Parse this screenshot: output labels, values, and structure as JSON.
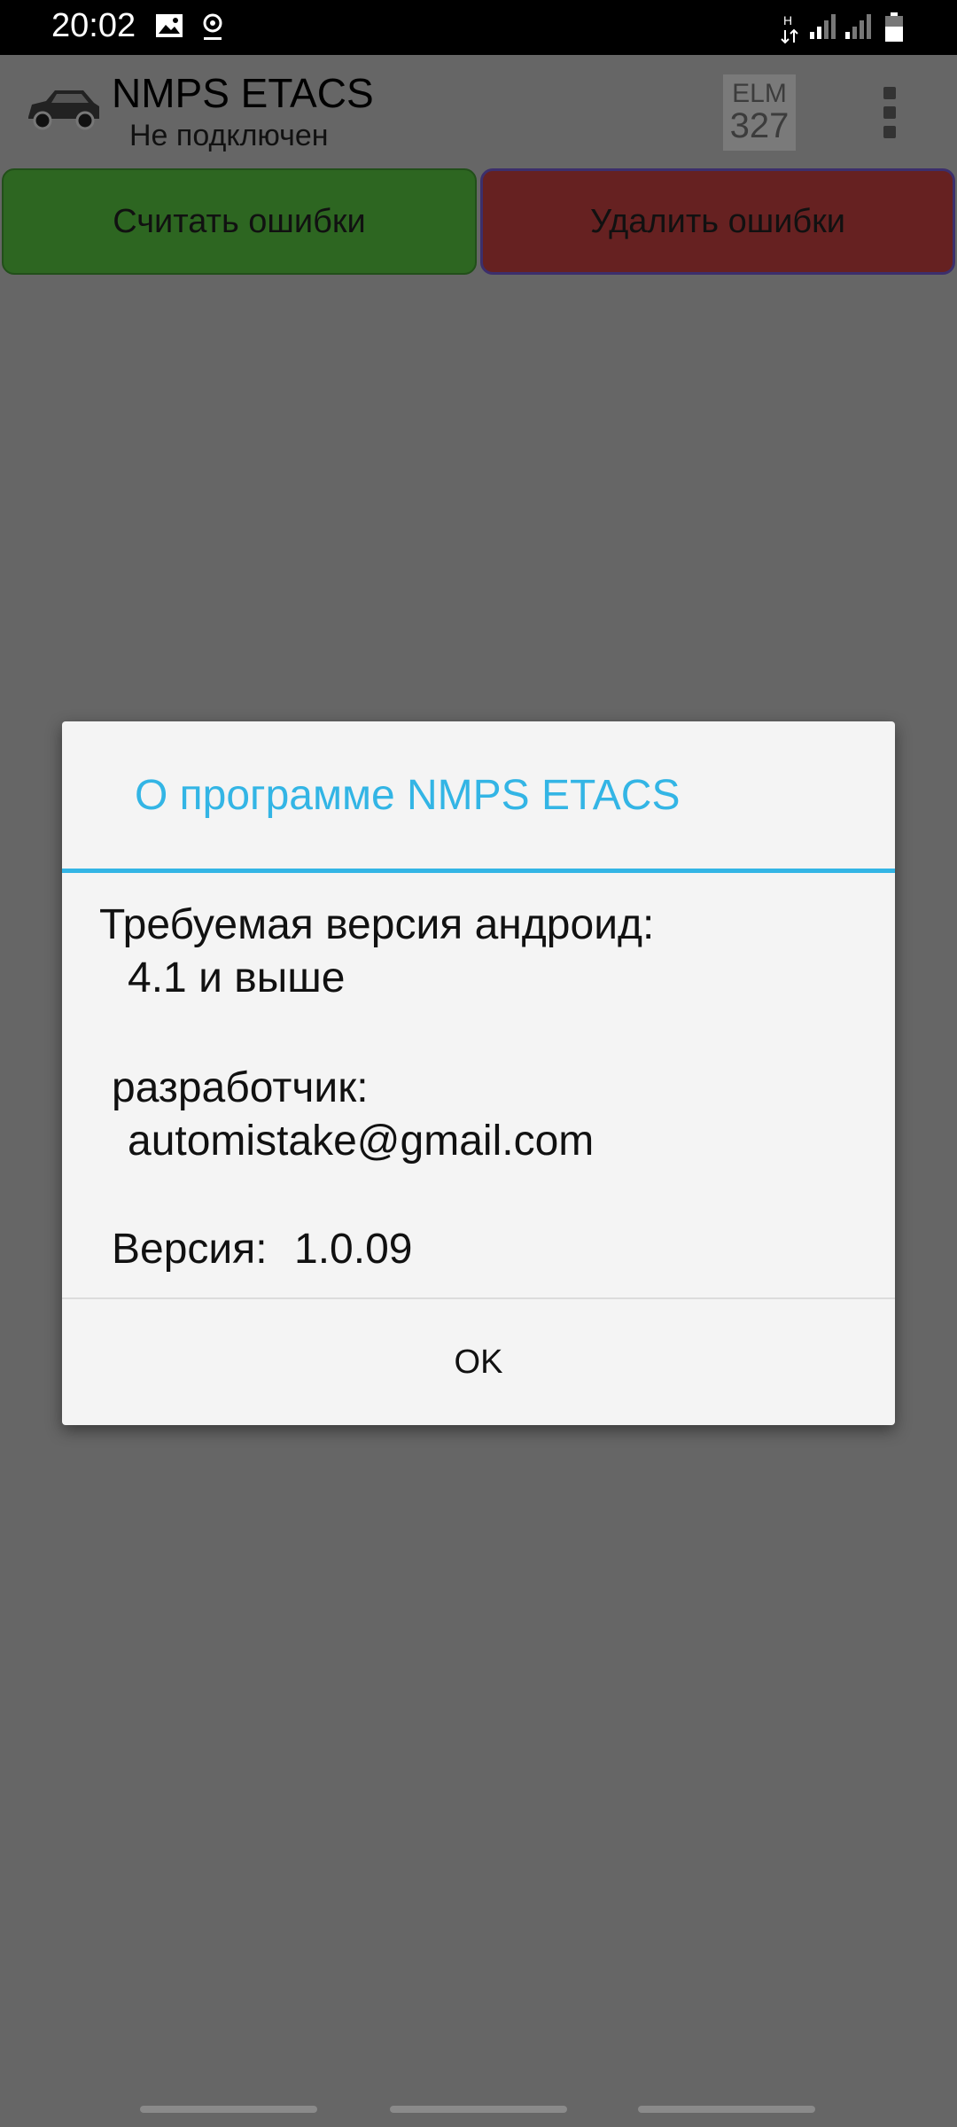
{
  "status_bar": {
    "time": "20:02",
    "icons": [
      "image-icon",
      "location-icon",
      "network-h-icon",
      "signal-icon",
      "signal-icon",
      "battery-icon"
    ]
  },
  "app_bar": {
    "title": "NMPS ETACS",
    "subtitle": "Не подключен",
    "elm_icon_top": "ELM",
    "elm_icon_bottom": "327"
  },
  "buttons": {
    "read_errors": "Считать ошибки",
    "delete_errors": "Удалить ошибки",
    "read_color": "#2d6621",
    "delete_color": "#662121"
  },
  "dialog": {
    "title": "О программе NMPS ETACS",
    "android_label": "Требуемая версия андроид:",
    "android_value": "4.1 и выше",
    "developer_label": "разработчик:",
    "developer_value": "automistake@gmail.com",
    "version_label": "Версия:",
    "version_value": "1.0.09",
    "ok_label": "OK",
    "accent_color": "#33b5e5"
  }
}
